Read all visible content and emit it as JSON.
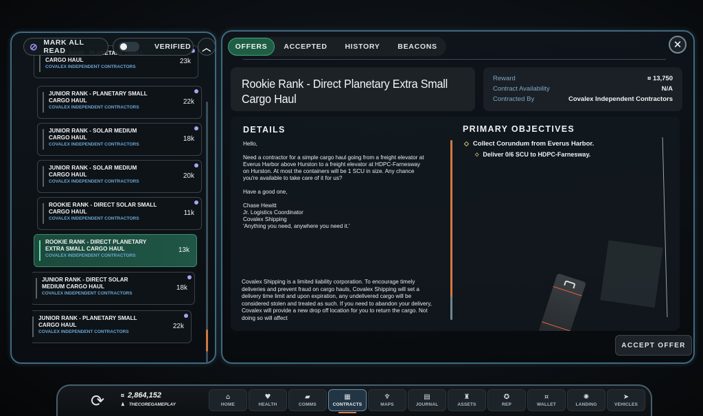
{
  "left_panel": {
    "mark_all_read_label": "MARK ALL READ",
    "verified_label": "VERIFIED",
    "verified_toggle_on": false,
    "offers": [
      {
        "title": "JUNIOR RANK - PLANETARY SMALL CARGO HAUL",
        "contractor": "COVALEX INDEPENDENT CONTRACTORS",
        "reward": "23k",
        "unread": true,
        "selected": false
      },
      {
        "title": "JUNIOR RANK - PLANETARY SMALL CARGO HAUL",
        "contractor": "COVALEX INDEPENDENT CONTRACTORS",
        "reward": "22k",
        "unread": true,
        "selected": false
      },
      {
        "title": "JUNIOR RANK - SOLAR MEDIUM CARGO HAUL",
        "contractor": "COVALEX INDEPENDENT CONTRACTORS",
        "reward": "18k",
        "unread": true,
        "selected": false
      },
      {
        "title": "JUNIOR RANK - SOLAR MEDIUM CARGO HAUL",
        "contractor": "COVALEX INDEPENDENT CONTRACTORS",
        "reward": "20k",
        "unread": true,
        "selected": false
      },
      {
        "title": "ROOKIE RANK - DIRECT SOLAR SMALL CARGO HAUL",
        "contractor": "COVALEX INDEPENDENT CONTRACTORS",
        "reward": "11k",
        "unread": true,
        "selected": false
      },
      {
        "title": "ROOKIE RANK - DIRECT PLANETARY EXTRA SMALL CARGO HAUL",
        "contractor": "COVALEX INDEPENDENT CONTRACTORS",
        "reward": "13k",
        "unread": false,
        "selected": true
      },
      {
        "title": "JUNIOR RANK - DIRECT SOLAR MEDIUM CARGO HAUL",
        "contractor": "COVALEX INDEPENDENT CONTRACTORS",
        "reward": "18k",
        "unread": true,
        "selected": false
      },
      {
        "title": "JUNIOR RANK - PLANETARY SMALL CARGO HAUL",
        "contractor": "COVALEX INDEPENDENT CONTRACTORS",
        "reward": "22k",
        "unread": true,
        "selected": false
      }
    ]
  },
  "tabs": [
    {
      "label": "OFFERS",
      "active": true
    },
    {
      "label": "ACCEPTED",
      "active": false
    },
    {
      "label": "HISTORY",
      "active": false
    },
    {
      "label": "BEACONS",
      "active": false
    }
  ],
  "contract": {
    "title": "Rookie Rank - Direct Planetary Extra Small Cargo Haul",
    "reward_label": "Reward",
    "reward_value": "¤ 13,750",
    "availability_label": "Contract Availability",
    "availability_value": "N/A",
    "contracted_by_label": "Contracted By",
    "contracted_by_value": "Covalex Independent Contractors",
    "details_heading": "DETAILS",
    "details_paragraphs": [
      "Hello,",
      "Need a contractor for a simple cargo haul going from a freight elevator at Everus Harbor above Hurston to a freight elevator at HDPC-Farnesway on Hurston. At most the containers will be 1 SCU in size. Any chance you're available to take care of it for us?",
      "Have a good one,"
    ],
    "signature": [
      "Chase Hewitt",
      "Jr. Logistics Coordinator",
      "Covalex Shipping",
      "'Anything you need, anywhere you need it.'"
    ],
    "legal_text": "Covalex Shipping is a limited liability corporation. To encourage timely deliveries and prevent fraud on cargo hauls, Covalex Shipping will set a delivery time limit and upon expiration, any undelivered cargo will be considered stolen and treated as such. If you need to abandon your delivery, Covalex will provide a new drop off location for you to return the cargo. Not doing so will affect",
    "objectives_heading": "PRIMARY OBJECTIVES",
    "objectives": [
      {
        "text": "Collect Corundum from Everus Harbor.",
        "level": 0
      },
      {
        "text": "Deliver 0/6 SCU to HDPC-Farnesway.",
        "level": 1
      }
    ],
    "accept_label": "ACCEPT OFFER"
  },
  "dock": {
    "credits": "2,864,152",
    "username": "THECOREGAMEPLAY",
    "nav": [
      {
        "label": "HOME",
        "icon": "home-icon",
        "glyph": "⌂",
        "active": false
      },
      {
        "label": "HEALTH",
        "icon": "heart-icon",
        "glyph": "♥",
        "active": false
      },
      {
        "label": "COMMS",
        "icon": "chat-icon",
        "glyph": "▰",
        "active": false
      },
      {
        "label": "CONTRACTS",
        "icon": "contracts-icon",
        "glyph": "▦",
        "active": true
      },
      {
        "label": "MAPS",
        "icon": "map-icon",
        "glyph": "♆",
        "active": false
      },
      {
        "label": "JOURNAL",
        "icon": "journal-icon",
        "glyph": "▤",
        "active": false
      },
      {
        "label": "ASSETS",
        "icon": "assets-icon",
        "glyph": "♜",
        "active": false
      },
      {
        "label": "REP",
        "icon": "rep-icon",
        "glyph": "✪",
        "active": false
      },
      {
        "label": "WALLET",
        "icon": "wallet-icon",
        "glyph": "¤",
        "active": false
      },
      {
        "label": "LANDING",
        "icon": "landing-icon",
        "glyph": "✺",
        "active": false
      },
      {
        "label": "VEHICLES",
        "icon": "vehicles-icon",
        "glyph": "➤",
        "active": false
      }
    ]
  }
}
